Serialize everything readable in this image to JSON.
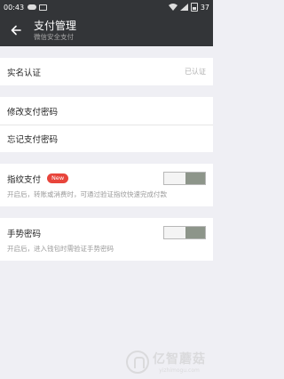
{
  "status_bar": {
    "time": "00:43",
    "battery_text": "37"
  },
  "header": {
    "title": "支付管理",
    "subtitle": "微信安全支付"
  },
  "section_identity": {
    "label": "实名认证",
    "status": "已认证"
  },
  "section_password": {
    "items": [
      {
        "label": "修改支付密码"
      },
      {
        "label": "忘记支付密码"
      }
    ]
  },
  "section_fingerprint": {
    "label": "指纹支付",
    "badge": "New",
    "enabled": false,
    "description": "开启后，转账或消费时，可通过验证指纹快速完成付款"
  },
  "section_gesture": {
    "label": "手势密码",
    "enabled": false,
    "description": "开启后，进入钱包时需验证手势密码"
  },
  "watermark": {
    "main": "亿智蘑菇",
    "sub": "yizhimogu.com"
  },
  "colors": {
    "header_bg": "#333538",
    "badge_red": "#e8453c",
    "toggle_knob": "#8d958a"
  }
}
